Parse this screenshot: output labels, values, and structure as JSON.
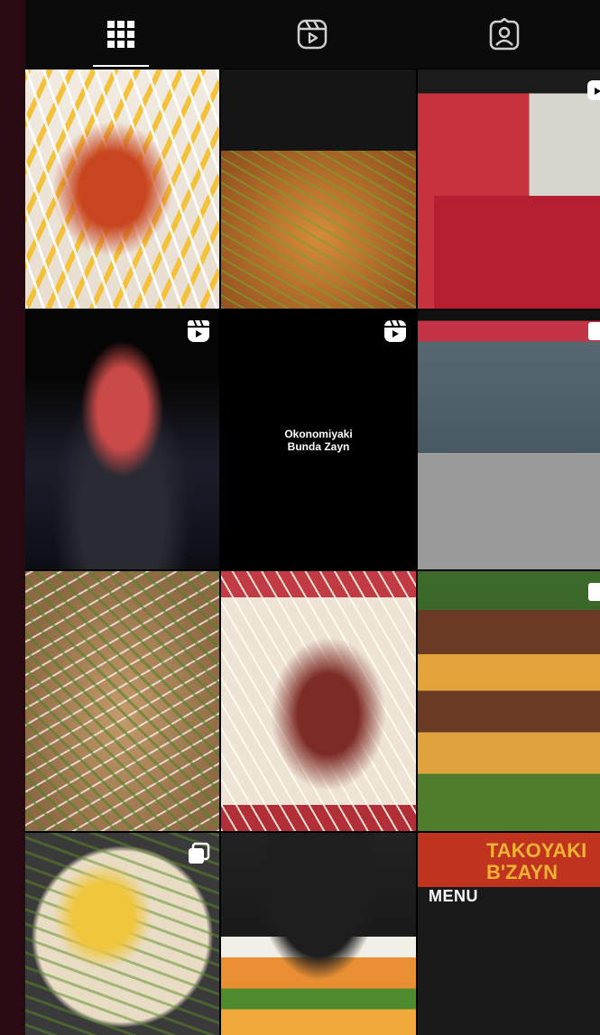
{
  "tabs": [
    {
      "id": "posts",
      "icon": "grid-icon",
      "active": true
    },
    {
      "id": "reels",
      "icon": "reels-icon",
      "active": false
    },
    {
      "id": "tagged",
      "icon": "tagged-person-icon",
      "active": false
    }
  ],
  "posts": [
    {
      "badge": null
    },
    {
      "badge": null
    },
    {
      "badge": "reels-icon"
    },
    {
      "badge": "reels-icon"
    },
    {
      "badge": "reels-icon",
      "title_line1": "Okonomiyaki",
      "title_line2": "Bunda Zayn"
    },
    {
      "badge": "carousel-icon"
    },
    {
      "badge": null
    },
    {
      "badge": null
    },
    {
      "badge": "carousel-icon"
    },
    {
      "badge": "carousel-icon"
    },
    {
      "badge": null
    },
    {
      "badge": null,
      "menu_label": "MENU",
      "brand_line1": "TAKOYAKI",
      "brand_line2": "B'ZAYN"
    }
  ]
}
